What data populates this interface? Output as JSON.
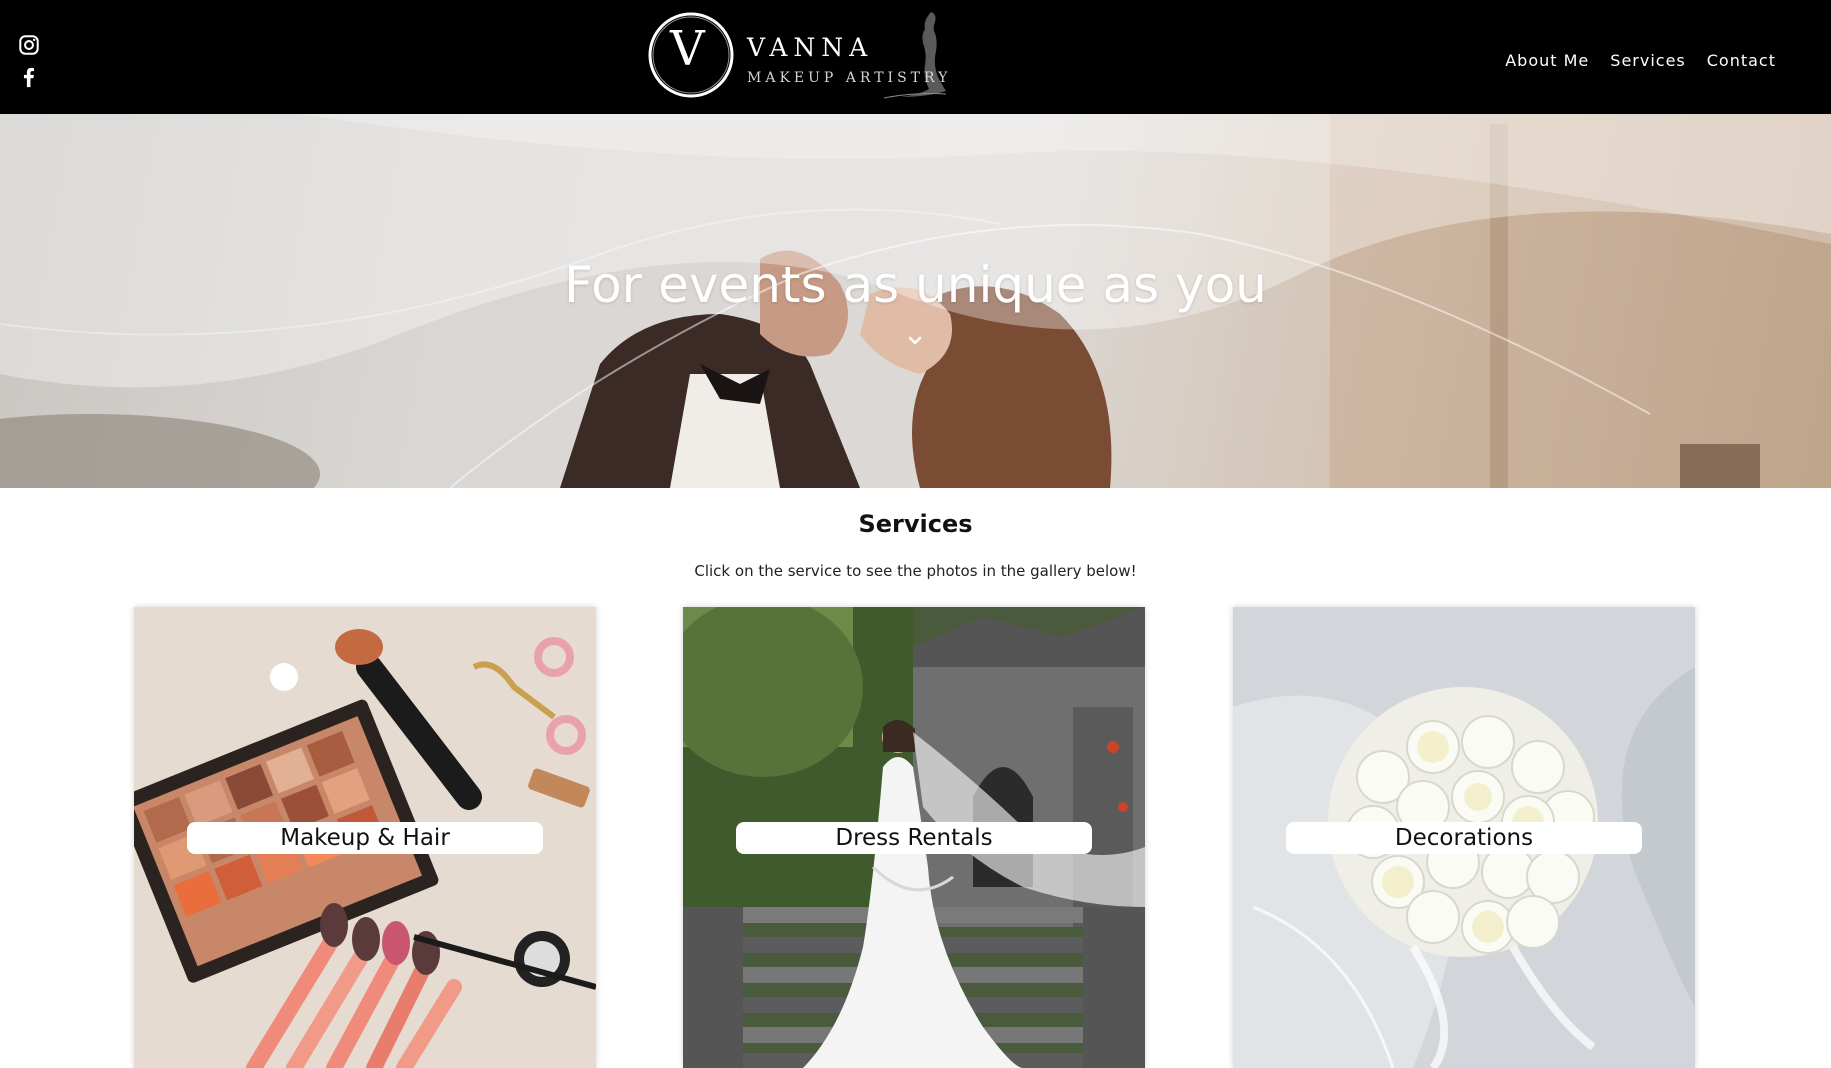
{
  "header": {
    "social": [
      {
        "name": "instagram-icon"
      },
      {
        "name": "facebook-icon"
      }
    ],
    "logo": {
      "monogram": "V",
      "name": "VANNA",
      "subtitle": "MAKEUP ARTISTRY"
    },
    "nav": [
      {
        "label": "About Me"
      },
      {
        "label": "Services"
      },
      {
        "label": "Contact"
      }
    ]
  },
  "hero": {
    "title": "For events as unique as you",
    "scroll_icon": "chevron-down-icon"
  },
  "services": {
    "title": "Services",
    "subtitle": "Click on the service to see the photos in the gallery below!",
    "cards": [
      {
        "label": "Makeup & Hair"
      },
      {
        "label": "Dress Rentals"
      },
      {
        "label": "Decorations"
      }
    ]
  },
  "colors": {
    "header_bg": "#000000",
    "page_bg": "#ffffff",
    "text": "#111111"
  }
}
